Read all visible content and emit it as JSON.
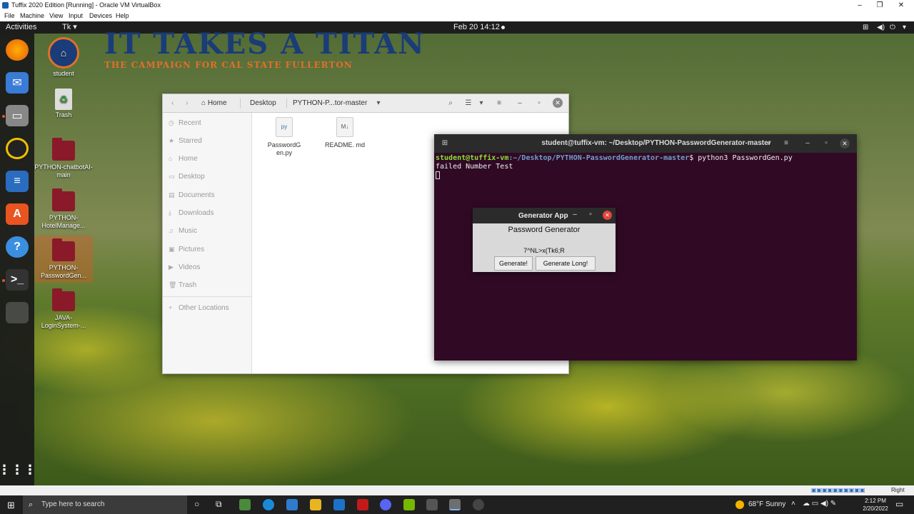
{
  "host": {
    "title": "Tuffix 2020 Edition [Running] - Oracle VM VirtualBox",
    "menu": [
      "File",
      "Machine",
      "View",
      "Input",
      "Devices",
      "Help"
    ]
  },
  "topbar": {
    "activities": "Activities",
    "app": "Tk ▾",
    "clock": "Feb 20  14:12"
  },
  "banner": {
    "line1": "IT TAKES A TITAN",
    "line2": "THE CAMPAIGN FOR CAL STATE FULLERTON"
  },
  "desktop": {
    "icons": [
      "student",
      "Trash",
      "PYTHON-chatbotAI-main",
      "PYTHON-HotelManage...",
      "PYTHON-PasswordGen...",
      "JAVA-LoginSystem-..."
    ]
  },
  "files": {
    "path": [
      "Home",
      "Desktop",
      "PYTHON-P...tor-master"
    ],
    "sidebar": [
      "Recent",
      "Starred",
      "Home",
      "Desktop",
      "Documents",
      "Downloads",
      "Music",
      "Pictures",
      "Videos",
      "Trash",
      "Other Locations"
    ],
    "items": [
      {
        "name": "PasswordGen.py",
        "display": "PasswordG en.py"
      },
      {
        "name": "README.md",
        "display": "README. md"
      }
    ]
  },
  "terminal": {
    "title": "student@tuffix-vm: ~/Desktop/PYTHON-PasswordGenerator-master",
    "user": "student@tuffix-vm",
    "path": ":~/Desktop/PYTHON-PasswordGenerator-master",
    "command": "$ python3 PasswordGen.py",
    "output": "failed Number Test"
  },
  "tkapp": {
    "title": "Generator App",
    "heading": "Password Generator",
    "password": "7^NL>x(Tk6;R",
    "btn_generate": "Generate!",
    "btn_long": "Generate Long!"
  },
  "statusstrip": {
    "hostkey": "Right Ctrl"
  },
  "taskbar": {
    "search_placeholder": "Type here to search",
    "weather": "68°F  Sunny",
    "time": "2:12 PM",
    "date": "2/20/2022"
  }
}
